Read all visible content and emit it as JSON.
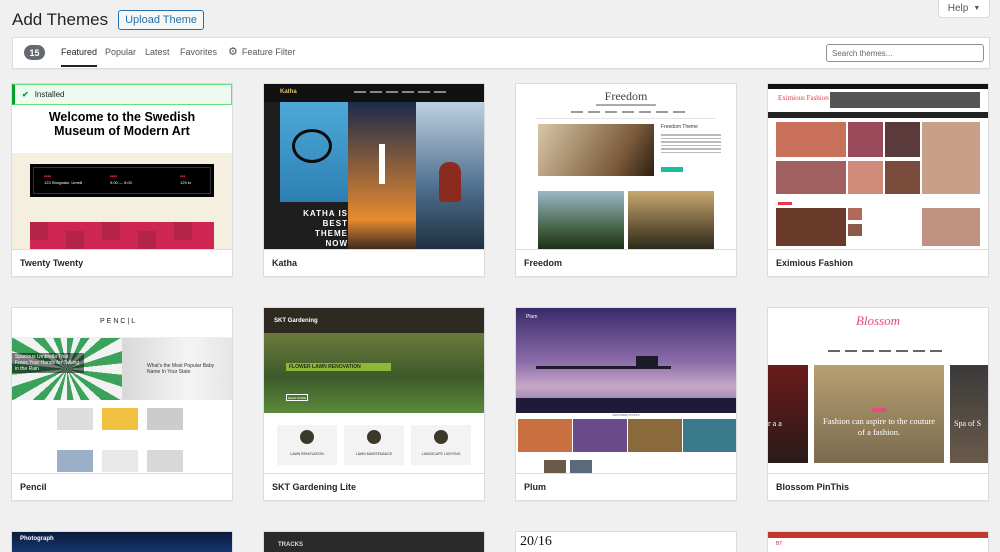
{
  "header": {
    "title": "Add Themes",
    "upload_label": "Upload Theme",
    "help_label": "Help"
  },
  "filter": {
    "count": "15",
    "tabs": [
      "Featured",
      "Popular",
      "Latest",
      "Favorites"
    ],
    "feature_filter": "Feature Filter",
    "search_placeholder": "Search themes..."
  },
  "themes": [
    {
      "name": "Twenty Twenty",
      "installed_label": "Installed",
      "preview_heading": "Welcome to the Swedish Museum of Modern Art",
      "address": "123 Storgatan, Umeå",
      "hours": "9:00 — 5:00",
      "price": "129 kr"
    },
    {
      "name": "Katha",
      "preview_logo": "Katha",
      "preview_text": "KATHA IS BEST THEME NOW"
    },
    {
      "name": "Freedom",
      "preview_logo": "Freedom",
      "preview_heading": "Freedom Theme"
    },
    {
      "name": "Eximious Fashion",
      "preview_logo": "Eximious Fashion"
    },
    {
      "name": "Pencil",
      "preview_logo": "PENC|L",
      "caption_left": "Spacious Umbrella That Frees Your Hands for Talking in the Rain",
      "caption_right": "What's the Most Popular Baby Name In Your State"
    },
    {
      "name": "SKT Gardening Lite",
      "preview_logo": "SKT Gardening",
      "banner": "FLOWER LAWN RENOVATION",
      "read_more": "READ MORE",
      "services": [
        "LAWN RENOVATION",
        "LAWN MAINTENANCE",
        "LANDSCAPE LIGHTING"
      ]
    },
    {
      "name": "Plum",
      "preview_logo": "Plum",
      "featured_label": "FEATURED POSTS"
    },
    {
      "name": "Blossom PinThis",
      "preview_logo": "Blossom",
      "caption": "Fashion can aspire to the couture of a fashion.",
      "caption_left": "r a a",
      "caption_right": "Spa of S"
    }
  ],
  "partial_row": [
    "Photograph",
    "TRACKS",
    "20/16",
    "BT"
  ],
  "colors": {
    "accent": "#2271b1",
    "installed_green": "#00a32a",
    "count_badge": "#646970"
  }
}
